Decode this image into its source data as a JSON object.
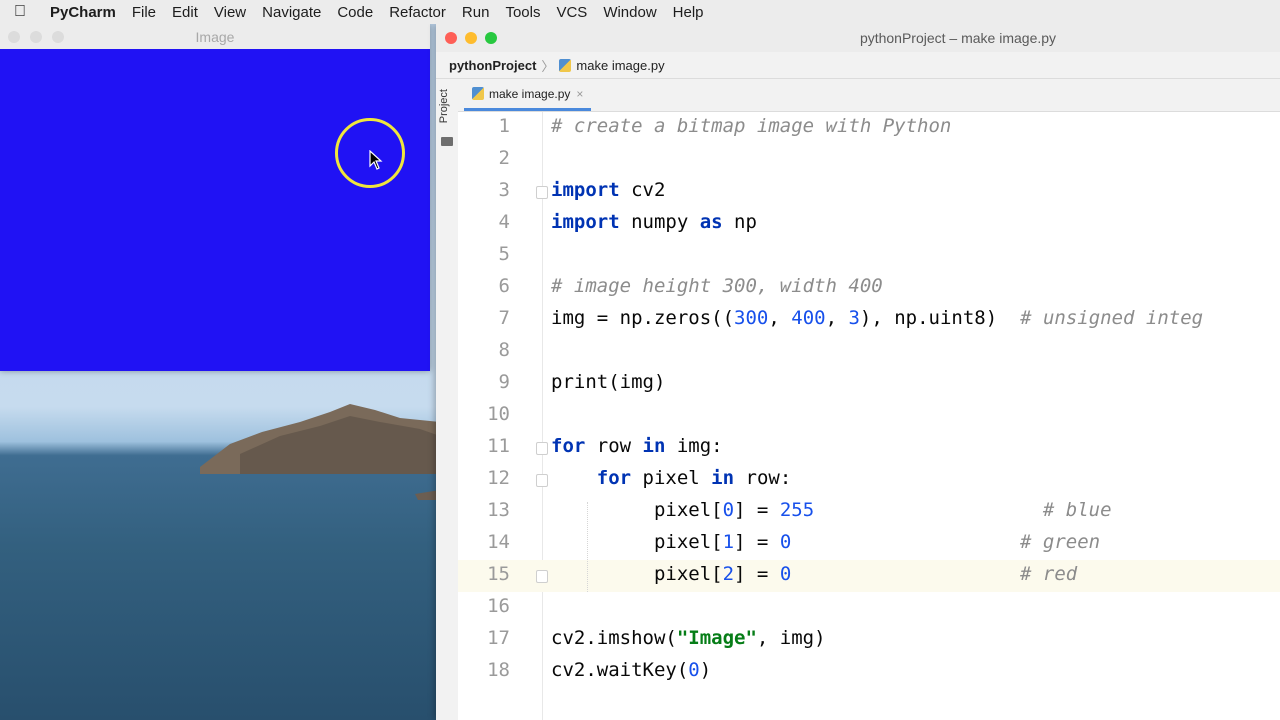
{
  "menubar": {
    "app_name": "PyCharm",
    "items": [
      "File",
      "Edit",
      "View",
      "Navigate",
      "Code",
      "Refactor",
      "Run",
      "Tools",
      "VCS",
      "Window",
      "Help"
    ]
  },
  "image_window": {
    "title": "Image",
    "fill_color": "#2012f4"
  },
  "ide": {
    "title": "pythonProject – make image.py",
    "breadcrumb": {
      "project": "pythonProject",
      "file": "make image.py"
    },
    "side_panel_label": "Project",
    "tab": {
      "label": "make image.py",
      "close_glyph": "×"
    },
    "current_line": 15,
    "lines": [
      {
        "n": "1"
      },
      {
        "n": "2"
      },
      {
        "n": "3"
      },
      {
        "n": "4"
      },
      {
        "n": "5"
      },
      {
        "n": "6"
      },
      {
        "n": "7"
      },
      {
        "n": "8"
      },
      {
        "n": "9"
      },
      {
        "n": "10"
      },
      {
        "n": "11"
      },
      {
        "n": "12"
      },
      {
        "n": "13"
      },
      {
        "n": "14"
      },
      {
        "n": "15"
      },
      {
        "n": "16"
      },
      {
        "n": "17"
      },
      {
        "n": "18"
      }
    ],
    "code": {
      "l1": "# create a bitmap image with Python",
      "l3_kw": "import",
      "l3_rest": " cv2",
      "l4_kw1": "import",
      "l4_mid": " numpy ",
      "l4_kw2": "as",
      "l4_rest": " np",
      "l6": "# image height 300, width 400",
      "l7_a": "img = np.zeros((",
      "l7_n1": "300",
      "l7_b": ", ",
      "l7_n2": "400",
      "l7_c": ", ",
      "l7_n3": "3",
      "l7_d": "), np.uint8)  ",
      "l7_cm": "# unsigned integ",
      "l9": "print(img)",
      "l11_kw1": "for",
      "l11_mid": " row ",
      "l11_kw2": "in",
      "l11_rest": " img:",
      "l12_kw1": "for",
      "l12_mid": " pixel ",
      "l12_kw2": "in",
      "l12_rest": " row:",
      "l13_a": "pixel[",
      "l13_i": "0",
      "l13_b": "] = ",
      "l13_v": "255",
      "l13_cm": "# blue",
      "l14_a": "pixel[",
      "l14_i": "1",
      "l14_b": "] = ",
      "l14_v": "0",
      "l14_cm": "# green",
      "l15_a": "pixel[",
      "l15_i": "2",
      "l15_b": "] = ",
      "l15_v": "0",
      "l15_cm": "# red",
      "l17_a": "cv2.imshow(",
      "l17_s": "\"Image\"",
      "l17_b": ", img)",
      "l18_a": "cv2.waitKey(",
      "l18_n": "0",
      "l18_b": ")"
    }
  },
  "colors": {
    "keyword": "#0033b3",
    "number": "#1750eb",
    "string": "#067d17",
    "comment": "#8c8c8c"
  }
}
